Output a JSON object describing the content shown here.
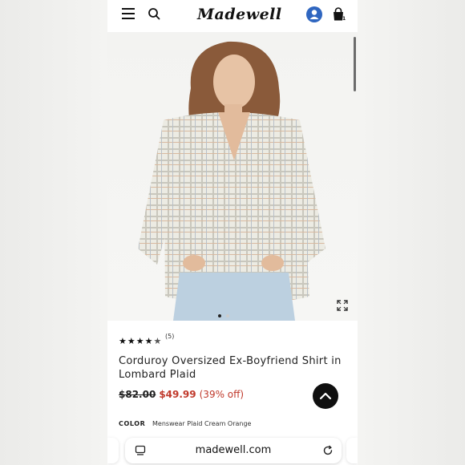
{
  "header": {
    "logo_text": "Madewell",
    "bag_count": "1"
  },
  "product": {
    "rating_stars": 4.5,
    "review_count": "(5)",
    "title": "Corduroy Oversized Ex-Boyfriend Shirt in Lombard Plaid",
    "price_old": "$82.00",
    "price_new": "$49.99",
    "discount": "(39% off)",
    "color_label": "COLOR",
    "color_value": "Menswear Plaid Cream Orange",
    "image_count": 2,
    "active_image": 1
  },
  "browser": {
    "url": "madewell.com"
  },
  "icons": {
    "menu": "hamburger-icon",
    "search": "search-icon",
    "account": "account-icon",
    "bag": "bag-icon",
    "expand": "expand-icon",
    "scroll_top": "chevron-up-icon",
    "tabs": "tabs-icon",
    "reload": "reload-icon"
  },
  "colors": {
    "accent_blue": "#2f66c0",
    "sale_red": "#c0392b",
    "text_dark": "#222222"
  }
}
